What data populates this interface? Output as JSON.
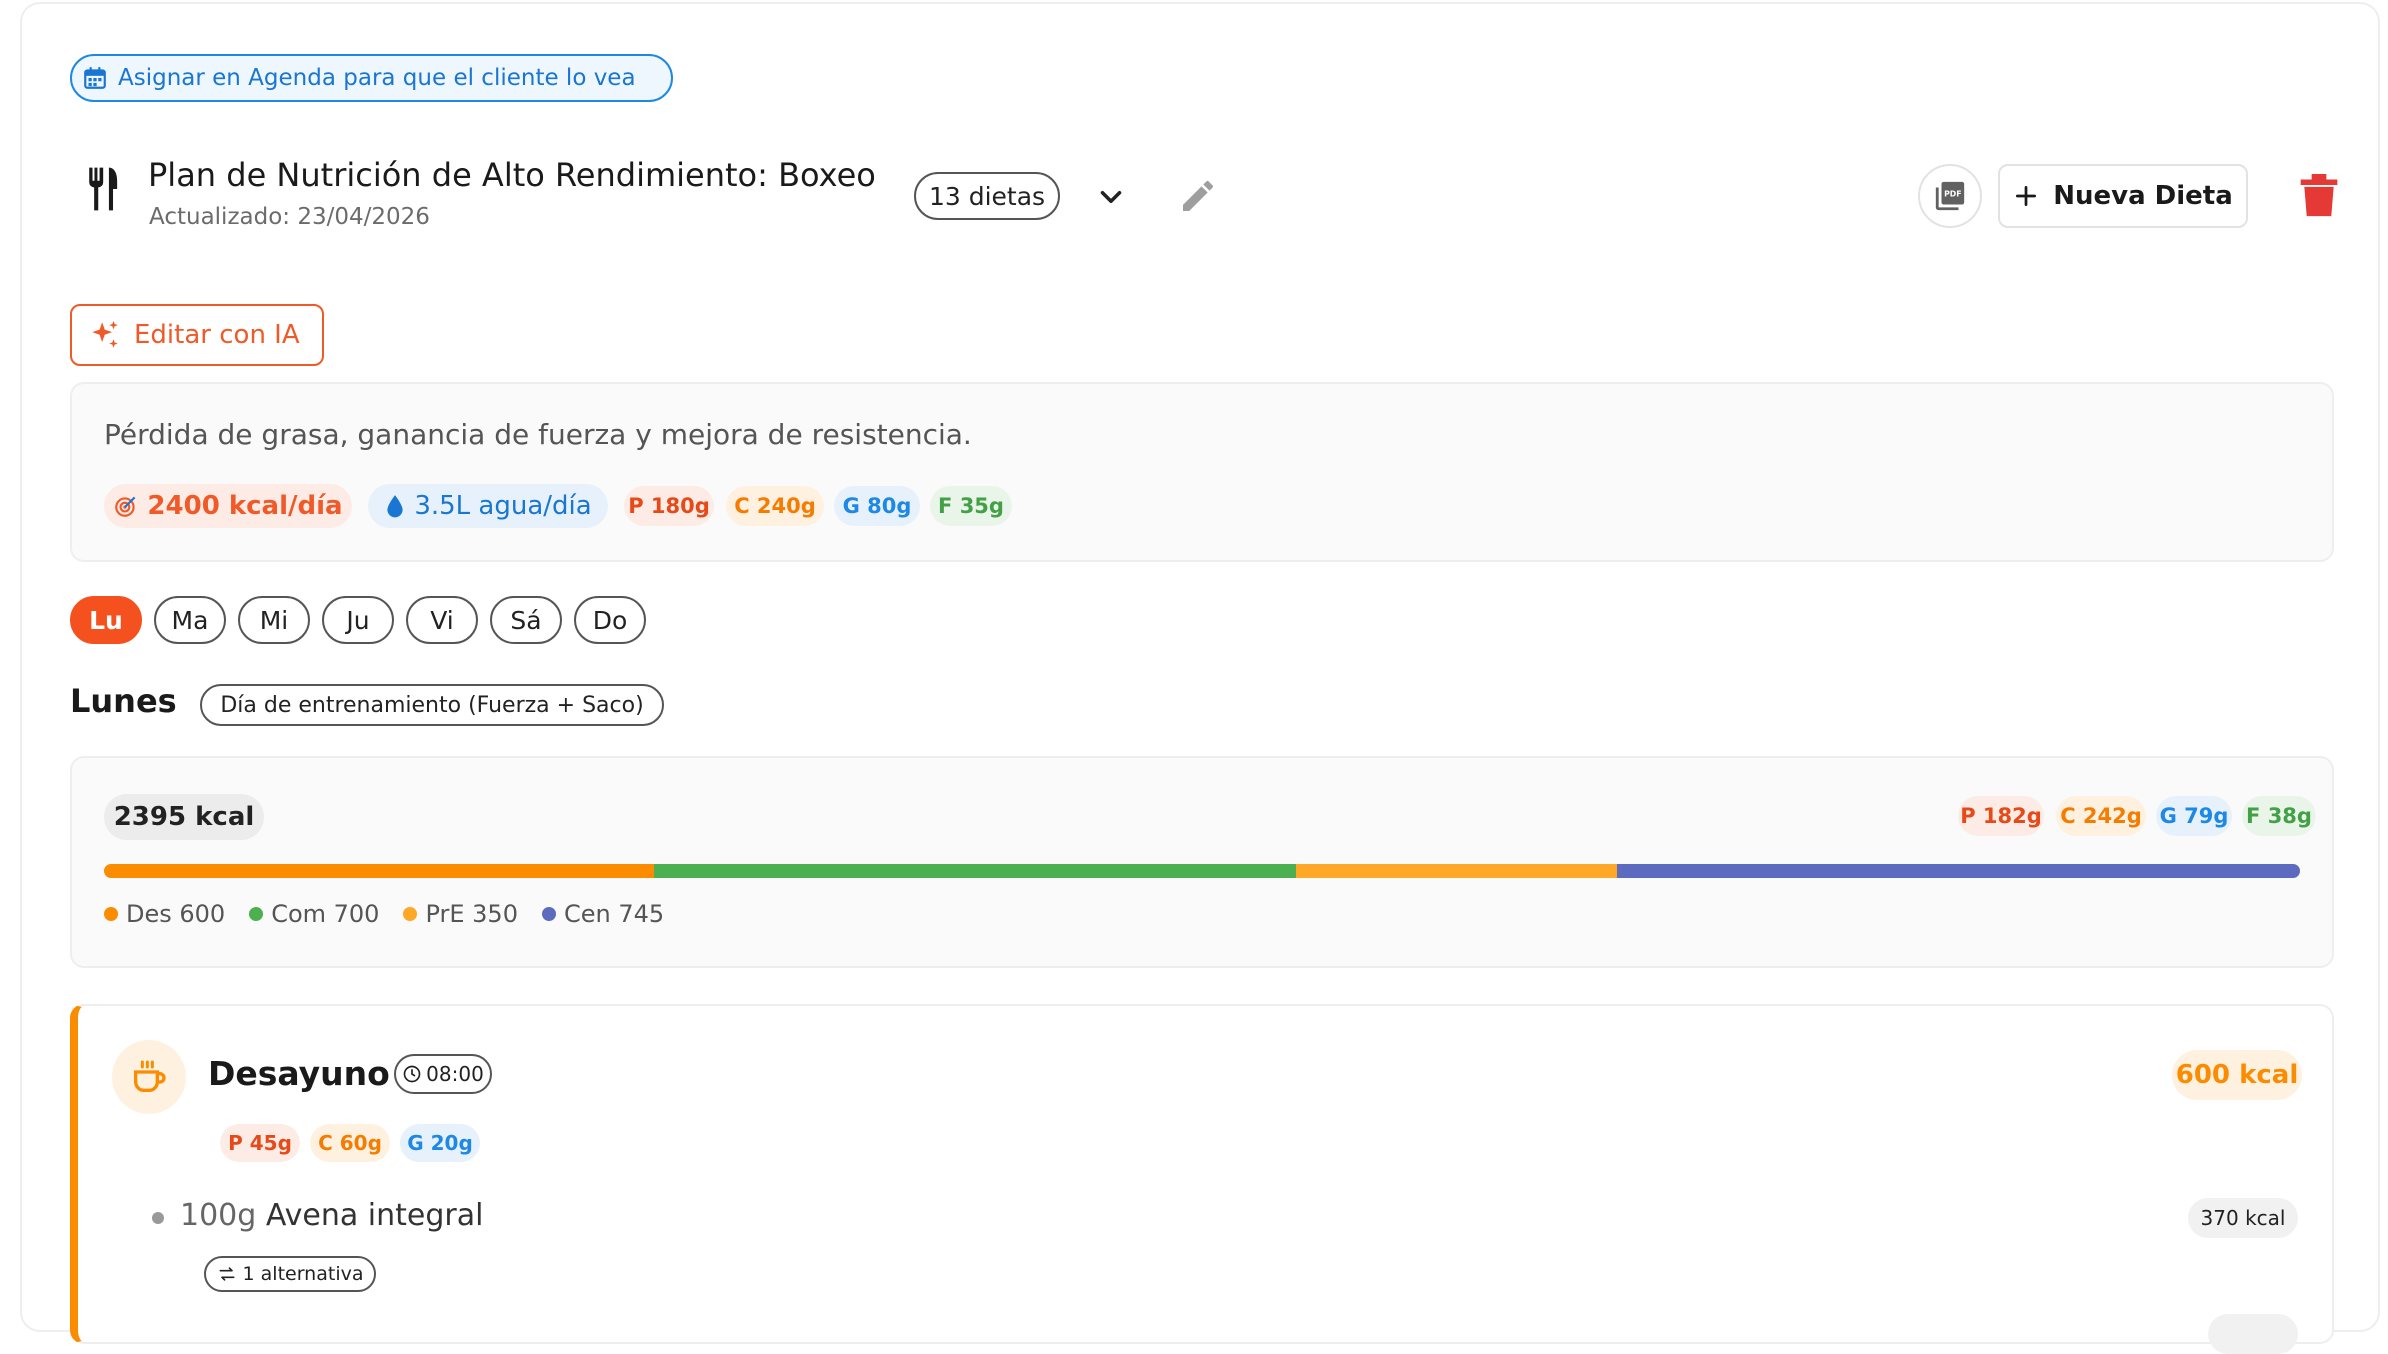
{
  "agenda": {
    "label": "Asignar en Agenda para que el cliente lo vea",
    "icon": "calendar-icon"
  },
  "plan": {
    "title": "Plan de Nutrición de Alto Rendimiento: Boxeo",
    "updated": "Actualizado: 23/04/2026",
    "diets_count": "13 dietas",
    "icons": [
      "utensils-icon",
      "chevron-down-icon",
      "pencil-icon",
      "pdf-icon",
      "trash-icon"
    ]
  },
  "toolbar": {
    "new_diet": "Nueva Dieta",
    "ai_edit": "Editar con IA"
  },
  "summary": {
    "goal": "Pérdida de grasa, ganancia de fuerza y mejora de resistencia.",
    "kcal": "2400 kcal/día",
    "water": "3.5L agua/día",
    "macros": {
      "p": "P 180g",
      "c": "C 240g",
      "g": "G 80g",
      "f": "F 35g"
    }
  },
  "days": [
    "Lu",
    "Ma",
    "Mi",
    "Ju",
    "Vi",
    "Sá",
    "Do"
  ],
  "active_day": "Lu",
  "day": {
    "name": "Lunes",
    "type": "Día de entrenamiento (Fuerza + Saco)",
    "total_kcal": "2395 kcal",
    "macros": {
      "p": "P 182g",
      "c": "C 242g",
      "g": "G 79g",
      "f": "F 38g"
    },
    "distribution": [
      {
        "label": "Des 600",
        "kcal": 600,
        "color": "#fb8c00"
      },
      {
        "label": "Com 700",
        "kcal": 700,
        "color": "#4caf50"
      },
      {
        "label": "PrE 350",
        "kcal": 350,
        "color": "#ffa726"
      },
      {
        "label": "Cen 745",
        "kcal": 745,
        "color": "#5c6bc0"
      }
    ]
  },
  "meal": {
    "name": "Desayuno",
    "time": "08:00",
    "kcal": "600 kcal",
    "macros": {
      "p": "P 45g",
      "c": "C 60g",
      "g": "G 20g"
    },
    "food": {
      "qty": "100g",
      "name": "Avena integral",
      "kcal": "370 kcal",
      "alternatives": "1 alternativa"
    }
  },
  "colors": {
    "accent": "#f4511e",
    "brand_blue": "#1976d2",
    "meal_accent": "#fb8c00",
    "danger": "#e53935"
  }
}
